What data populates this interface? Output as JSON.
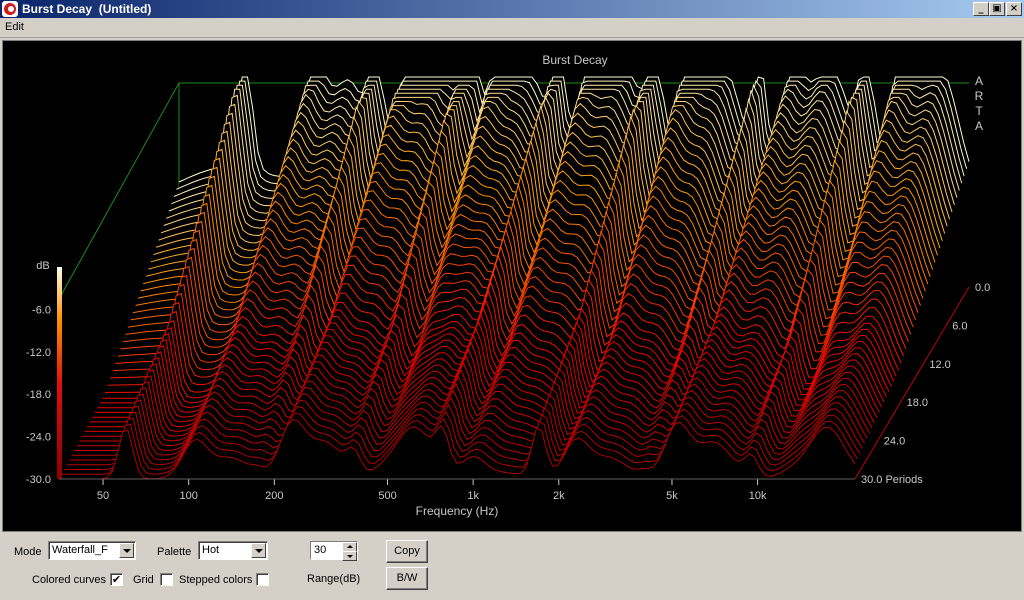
{
  "window": {
    "title": "Burst Decay  (Untitled)"
  },
  "menu": {
    "items": [
      "Edit"
    ]
  },
  "colors": {
    "line_hot": "#ffffcc",
    "line_mid": "#ff8c00",
    "line_cold": "#c80000",
    "frame": "#1a8a1a",
    "text": "#c8c8c8"
  },
  "chart_data": {
    "type": "waterfall",
    "title": "Burst Decay",
    "brand": "ARTA",
    "xlabel": "Frequency (Hz)",
    "x_ticks": [
      "50",
      "100",
      "200",
      "500",
      "1k",
      "2k",
      "5k",
      "10k"
    ],
    "x_tick_values": [
      50,
      100,
      200,
      500,
      1000,
      2000,
      5000,
      10000
    ],
    "xlim": [
      35,
      22000
    ],
    "x_scale": "log",
    "zlabel": "dB",
    "z_ticks": [
      "-6.0",
      "-12.0",
      "-18.0",
      "-24.0",
      "-30.0"
    ],
    "zlim": [
      -30,
      0
    ],
    "ylabel": "Periods",
    "y_ticks": [
      "0.0",
      "6.0",
      "12.0",
      "18.0",
      "24.0",
      "30.0 Periods"
    ],
    "ylim": [
      0,
      30
    ],
    "palette": "Hot"
  },
  "controls": {
    "mode_label": "Mode",
    "mode_value": "Waterfall_F",
    "palette_label": "Palette",
    "palette_value": "Hot",
    "range_value": "30",
    "range_label": "Range(dB)",
    "copy_label": "Copy",
    "bw_label": "B/W",
    "colored_curves_label": "Colored curves",
    "colored_curves_checked": true,
    "grid_label": "Grid",
    "grid_checked": false,
    "stepped_colors_label": "Stepped colors",
    "stepped_colors_checked": false
  }
}
